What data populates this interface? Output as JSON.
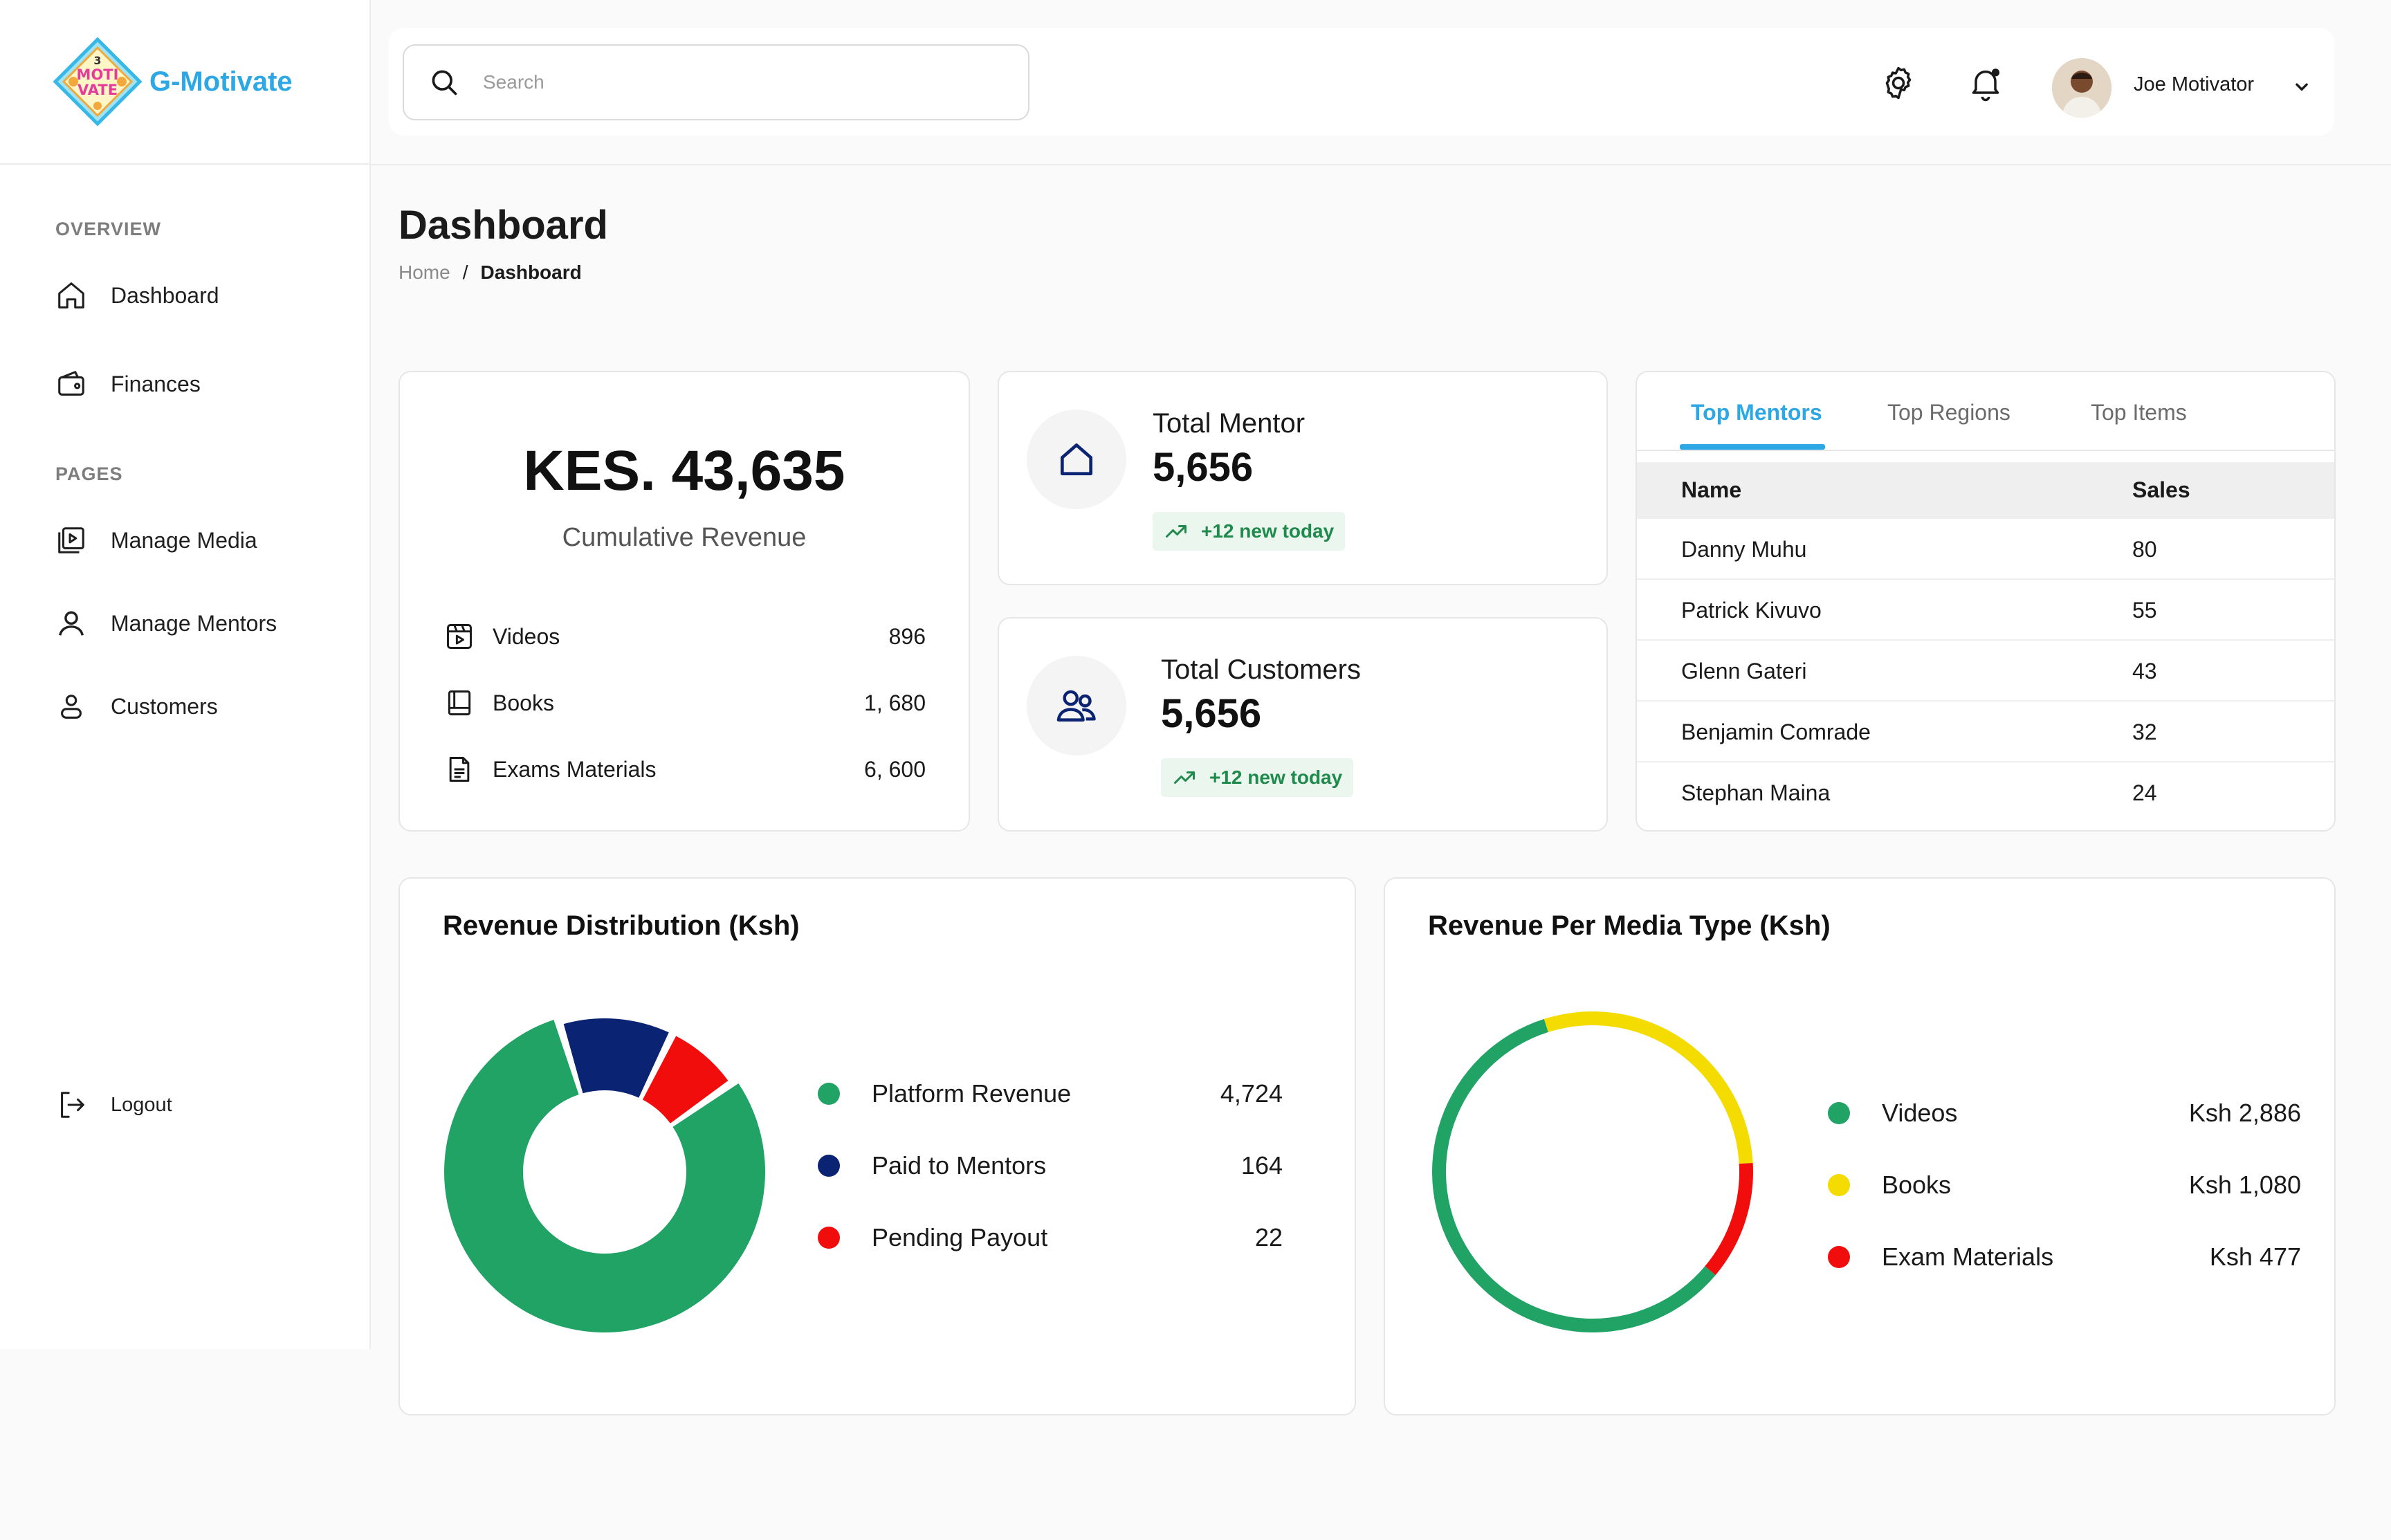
{
  "brand": {
    "name": "G-Motivate",
    "logo_text_top": "MOTI",
    "logo_text_bottom": "VATE"
  },
  "sidebar": {
    "sections": [
      "OVERVIEW",
      "PAGES"
    ],
    "items": [
      {
        "label": "Dashboard",
        "icon": "home-icon"
      },
      {
        "label": "Finances",
        "icon": "wallet-icon"
      },
      {
        "label": "Manage Media",
        "icon": "media-icon"
      },
      {
        "label": "Manage Mentors",
        "icon": "mentor-icon"
      },
      {
        "label": "Customers",
        "icon": "user-icon"
      }
    ],
    "logout_label": "Logout"
  },
  "header": {
    "search_placeholder": "Search",
    "user_name": "Joe Motivator"
  },
  "page": {
    "title": "Dashboard",
    "breadcrumb": [
      "Home",
      "/",
      "Dashboard"
    ]
  },
  "revenue_card": {
    "amount": "KES. 43,635",
    "label": "Cumulative Revenue",
    "rows": [
      {
        "label": "Videos",
        "value": "896",
        "icon": "video-icon"
      },
      {
        "label": "Books",
        "value": "1, 680",
        "icon": "book-icon"
      },
      {
        "label": "Exams Materials",
        "value": "6, 600",
        "icon": "document-icon"
      }
    ]
  },
  "stats": [
    {
      "title": "Total Mentor",
      "value": "5,656",
      "badge": "+12 new today",
      "icon": "home-icon"
    },
    {
      "title": "Total Customers",
      "value": "5,656",
      "badge": "+12 new today",
      "icon": "users-icon"
    }
  ],
  "top_card": {
    "tabs": [
      "Top Mentors",
      "Top Regions",
      "Top Items"
    ],
    "active_tab": 0,
    "columns": [
      "Name",
      "Sales"
    ],
    "rows": [
      [
        "Danny Muhu",
        "80"
      ],
      [
        "Patrick Kivuvo",
        "55"
      ],
      [
        "Glenn Gateri",
        "43"
      ],
      [
        "Benjamin Comrade",
        "32"
      ],
      [
        "Stephan Maina",
        "24"
      ]
    ]
  },
  "colors": {
    "accent": "#2ea8e5",
    "green": "#21a366",
    "navy": "#0b2373",
    "red": "#f20d0d",
    "yellow": "#f5dc00"
  },
  "chart_data": [
    {
      "type": "pie",
      "title": "Revenue Distribution (Ksh)",
      "categories": [
        "Platform Revenue",
        "Paid to Mentors",
        "Pending Payout"
      ],
      "values": [
        4724,
        164,
        22
      ],
      "value_labels": [
        "4,724",
        "164",
        "22"
      ],
      "colors": [
        "#21a366",
        "#0b2373",
        "#f20d0d"
      ],
      "shape_proportions": [
        0.8,
        0.12,
        0.08
      ]
    },
    {
      "type": "pie",
      "title": "Revenue Per Media Type (Ksh)",
      "categories": [
        "Videos",
        "Books",
        "Exam Materials"
      ],
      "values": [
        2886,
        1080,
        477
      ],
      "value_labels": [
        "Ksh 2,886",
        "Ksh 1,080",
        "Ksh 477"
      ],
      "colors": [
        "#21a366",
        "#f5dc00",
        "#f20d0d"
      ],
      "shape_proportions": [
        0.59,
        0.29,
        0.12
      ]
    }
  ]
}
